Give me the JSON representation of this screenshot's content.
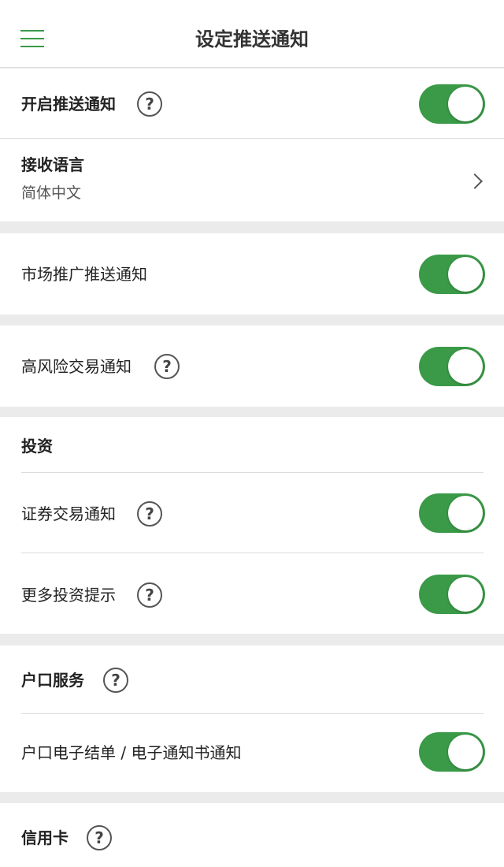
{
  "header": {
    "title": "设定推送通知",
    "menu_icon": "hamburger-menu-icon"
  },
  "colors": {
    "accent": "#3a9a47",
    "background": "#ebebeb",
    "card": "#ffffff",
    "divider": "#dcdcdc"
  },
  "help_glyph": "?",
  "section1": {
    "push_enable": {
      "label": "开启推送通知",
      "on": true
    },
    "language": {
      "label": "接收语言",
      "value": "简体中文"
    }
  },
  "marketing": {
    "label": "市场推广推送通知",
    "on": true
  },
  "high_risk": {
    "label": "高风险交易通知",
    "on": true
  },
  "investment": {
    "title": "投资",
    "securities": {
      "label": "证券交易通知",
      "on": true
    },
    "more_tips": {
      "label": "更多投资提示",
      "on": true
    }
  },
  "account": {
    "title": "户口服务",
    "estatement": {
      "label": "户口电子结单 / 电子通知书通知",
      "on": true
    }
  },
  "credit_card": {
    "title": "信用卡"
  }
}
